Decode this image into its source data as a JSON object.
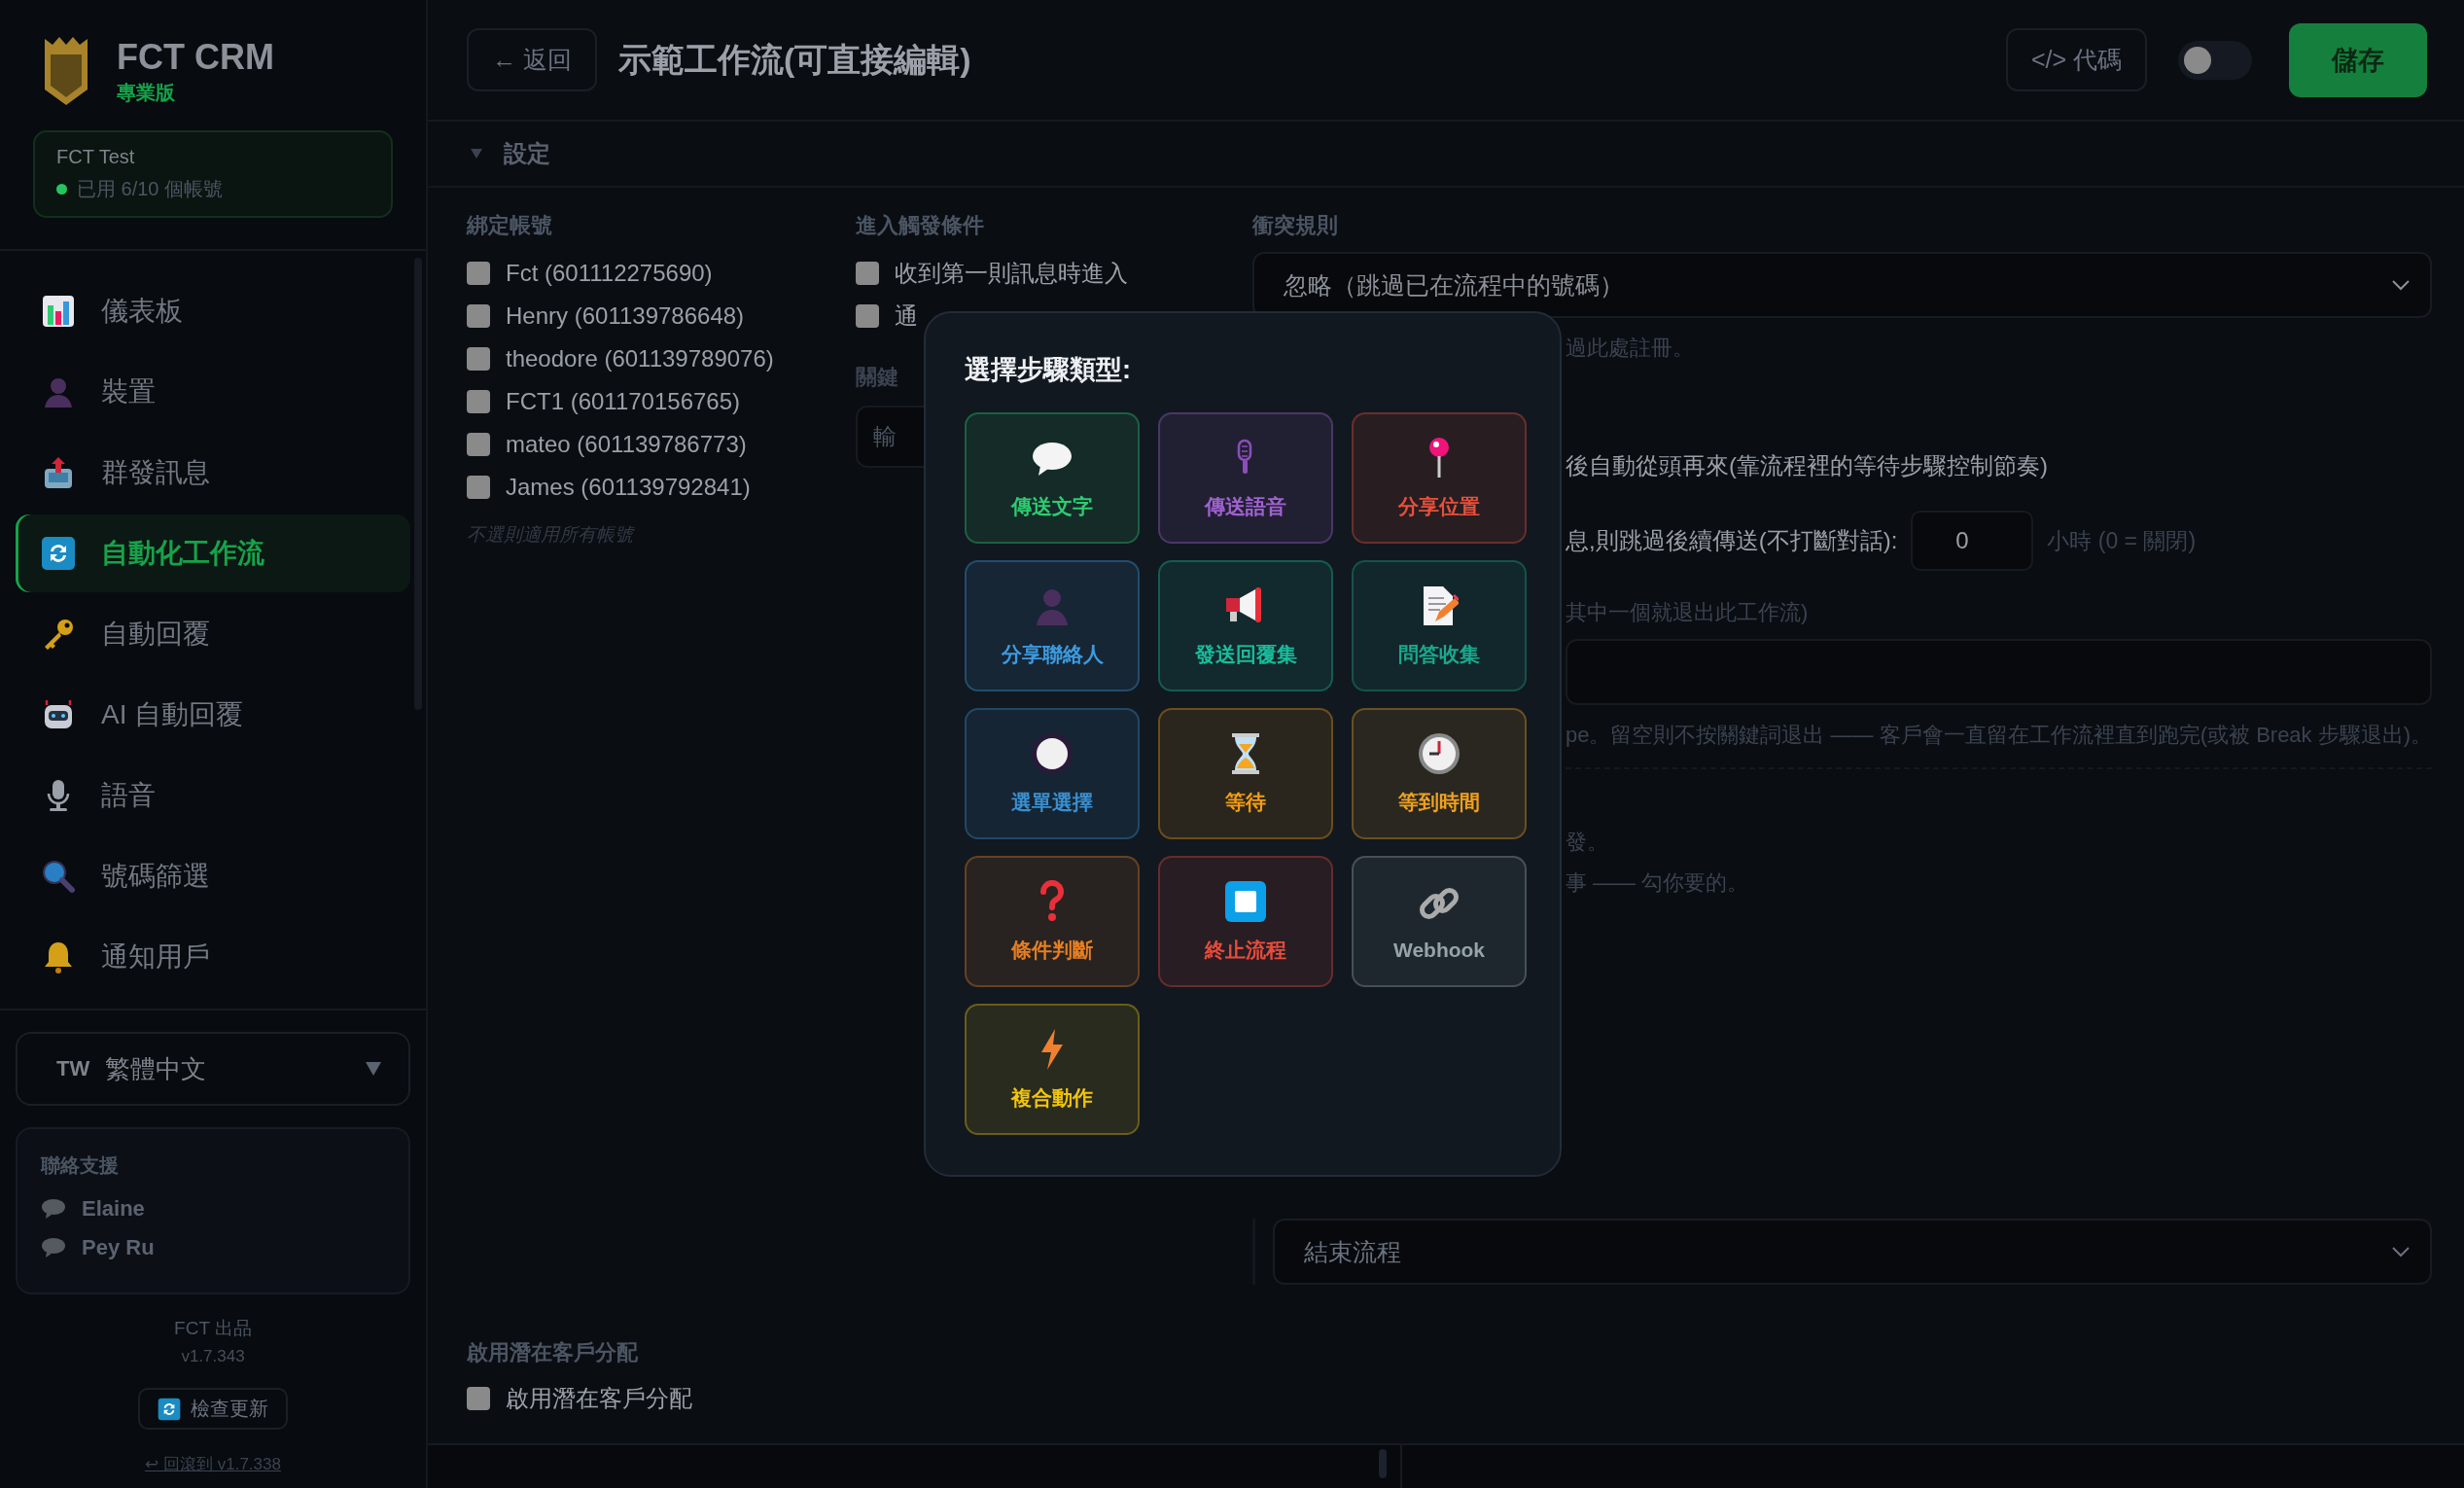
{
  "sidebar": {
    "brand": {
      "name": "FCT CRM",
      "edition": "專業版"
    },
    "account": {
      "name": "FCT Test",
      "status": "已用 6/10 個帳號"
    },
    "nav": [
      {
        "label": "儀表板",
        "selected": false
      },
      {
        "label": "裝置",
        "selected": false
      },
      {
        "label": "群發訊息",
        "selected": false
      },
      {
        "label": "自動化工作流",
        "selected": true
      },
      {
        "label": "自動回覆",
        "selected": false
      },
      {
        "label": "AI 自動回覆",
        "selected": false
      },
      {
        "label": "語音",
        "selected": false
      },
      {
        "label": "號碼篩選",
        "selected": false
      },
      {
        "label": "通知用戶",
        "selected": false
      }
    ],
    "language": {
      "code": "TW",
      "value": "繁體中文"
    },
    "support": {
      "title": "聯絡支援",
      "contacts": [
        "Elaine",
        "Pey Ru"
      ]
    },
    "footer": {
      "maker": "FCT 出品",
      "version": "v1.7.343",
      "update_button": "檢查更新",
      "rollback_link": "↩ 回滾到 v1.7.338"
    }
  },
  "header": {
    "back_button": "← 返回",
    "title": "示範工作流(可直接編輯)",
    "code_button": "</> 代碼",
    "toggle": {
      "on": false
    },
    "save_button": "儲存"
  },
  "settings": {
    "title": "設定",
    "expanded": true
  },
  "bind_accounts": {
    "label": "綁定帳號",
    "accounts": [
      {
        "label": "Fct (601112275690)",
        "checked": false
      },
      {
        "label": "Henry (601139786648)",
        "checked": false
      },
      {
        "label": "theodore (601139789076)",
        "checked": false
      },
      {
        "label": "FCT1 (601170156765)",
        "checked": false
      },
      {
        "label": "mateo (601139786773)",
        "checked": false
      },
      {
        "label": "James (601139792841)",
        "checked": false
      }
    ],
    "hint": "不選則適用所有帳號"
  },
  "trigger": {
    "label": "進入觸發條件",
    "options": [
      {
        "label": "收到第一則訊息時進入",
        "checked": false
      },
      {
        "label": "通",
        "checked": false
      }
    ],
    "keyword_label": "關鍵",
    "keyword_placeholder": "輸"
  },
  "conflict": {
    "label": "衝突規則",
    "value": "忽略（跳過已在流程中的號碼）",
    "hint": "過此處註冊。",
    "loop_option": "後自動從頭再來(靠流程裡的等待步驟控制節奏)",
    "skip_option": "息,則跳過後續傳送(不打斷對話):",
    "skip_hours": "0",
    "skip_unit": "小時 (0 = 關閉)",
    "exit_label": "其中一個就退出此工作流)",
    "exit_hint": "pe。留空則不按關鍵詞退出 —— 客戶會一直留在工作流裡直到跑完(或被 Break 步驟退出)。",
    "note_1": "發。",
    "note_2": "事 —— 勾你要的。",
    "after_break": "結束流程"
  },
  "lead_assignment": {
    "label": "啟用潛在客戶分配",
    "option": {
      "label": "啟用潛在客戶分配",
      "checked": false
    }
  },
  "step_picker": {
    "title": "選擇步驟類型:",
    "steps": [
      {
        "label": "傳送文字",
        "color": "#2ecc71"
      },
      {
        "label": "傳送語音",
        "color": "#a062d0"
      },
      {
        "label": "分享位置",
        "color": "#e8503a"
      },
      {
        "label": "分享聯絡人",
        "color": "#3d9be0"
      },
      {
        "label": "發送回覆集",
        "color": "#1abc9c"
      },
      {
        "label": "問答收集",
        "color": "#1aa88c"
      },
      {
        "label": "選單選擇",
        "color": "#3a8fd0"
      },
      {
        "label": "等待",
        "color": "#f39c12"
      },
      {
        "label": "等到時間",
        "color": "#f0a020"
      },
      {
        "label": "條件判斷",
        "color": "#e67e22"
      },
      {
        "label": "終止流程",
        "color": "#e74c3c"
      },
      {
        "label": "Webhook",
        "color": "#95a5a6"
      },
      {
        "label": "複合動作",
        "color": "#f1c40f"
      }
    ]
  }
}
